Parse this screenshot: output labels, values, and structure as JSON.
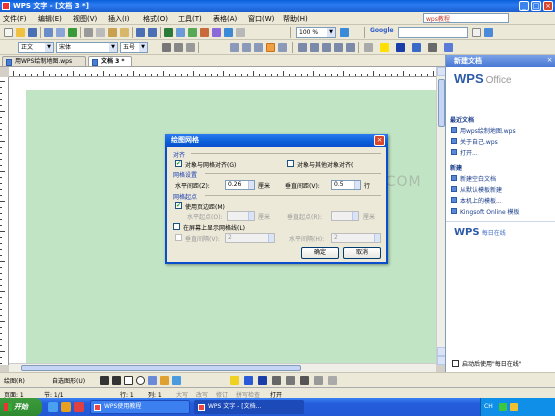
{
  "window": {
    "title": "WPS 文字 - [文档 3 *]",
    "help_box": "wps教程",
    "controls": [
      "_",
      "□",
      "×"
    ]
  },
  "menu": [
    {
      "label": "文件(F)"
    },
    {
      "label": "编辑(E)"
    },
    {
      "label": "视图(V)"
    },
    {
      "label": "插入(I)"
    },
    {
      "label": "格式(O)"
    },
    {
      "label": "工具(T)"
    },
    {
      "label": "表格(A)"
    },
    {
      "label": "窗口(W)"
    },
    {
      "label": "帮助(H)"
    }
  ],
  "toolbar": {
    "zoom": "100 %",
    "search": "Google",
    "search_placeholder": "",
    "style": "正文",
    "font": "宋体",
    "size": "五号"
  },
  "tabs": [
    {
      "label": "用WPS绘制地图.wps"
    },
    {
      "label": "文档 3 *"
    }
  ],
  "taskpane": {
    "title": "新建文档",
    "logo": {
      "a": "WPS",
      "b": "Office"
    },
    "sections": [
      {
        "title": "最近文档",
        "items": [
          {
            "label": "用wps绘制地图.wps"
          },
          {
            "label": "关于自己.wps"
          },
          {
            "label": "打开..."
          }
        ]
      },
      {
        "title": "新建",
        "items": [
          {
            "label": "新建空白文档"
          },
          {
            "label": "从默认模板新建"
          },
          {
            "label": "本机上的模板..."
          },
          {
            "label": "Kingsoft Online 模板"
          }
        ]
      }
    ],
    "online": {
      "a": "WPS",
      "b": "每日在线"
    },
    "blurb": "",
    "startup_checkbox": "启动后使用\"每日在线\""
  },
  "dialog": {
    "title": "绘图网格",
    "close": "×",
    "align_label": "对齐",
    "snap_grid": {
      "label": "对象与网格对齐(G)",
      "checked": true
    },
    "snap_objects": {
      "label": "对象与其他对象对齐(",
      "checked": false
    },
    "grid_settings_label": "网格设置",
    "h_spacing": {
      "label": "水平间距(Z):",
      "value": "0.26",
      "unit": "厘米"
    },
    "v_spacing": {
      "label": "垂直间距(V):",
      "value": "0.5",
      "unit": "行"
    },
    "grid_origin_label": "网格起点",
    "use_margins": {
      "label": "使用页边距(M)",
      "checked": true
    },
    "h_origin": {
      "label": "水平起点(O):",
      "value": "",
      "unit": "厘米"
    },
    "v_origin": {
      "label": "垂直起点(R):",
      "value": "",
      "unit": "厘米"
    },
    "show_lines": {
      "label": "在屏幕上显示网格线(L)",
      "checked": false
    },
    "v_interval": {
      "label": "垂直间隔(V):",
      "value": "2"
    },
    "h_interval": {
      "label": "水平间隔(H):",
      "value": "2"
    },
    "ok": "确定",
    "cancel": "取消"
  },
  "drawbar": {
    "draw": "绘图(R)",
    "autoshapes": "自选图形(U)"
  },
  "status": {
    "page": "页面: 1",
    "section": "节: 1/1",
    "row": "行: 1",
    "col": "列: 1",
    "items": [
      "大写",
      "改写",
      "修订",
      "拼写检查",
      "打开"
    ]
  },
  "taskbar": {
    "start": "开始",
    "tasks": [
      {
        "label": "WPS使用教程"
      },
      {
        "label": "WPS 文字 - [文档..."
      }
    ],
    "clock": "",
    "ime": "CH"
  },
  "watermark": "WWW.3LIAN.COM"
}
